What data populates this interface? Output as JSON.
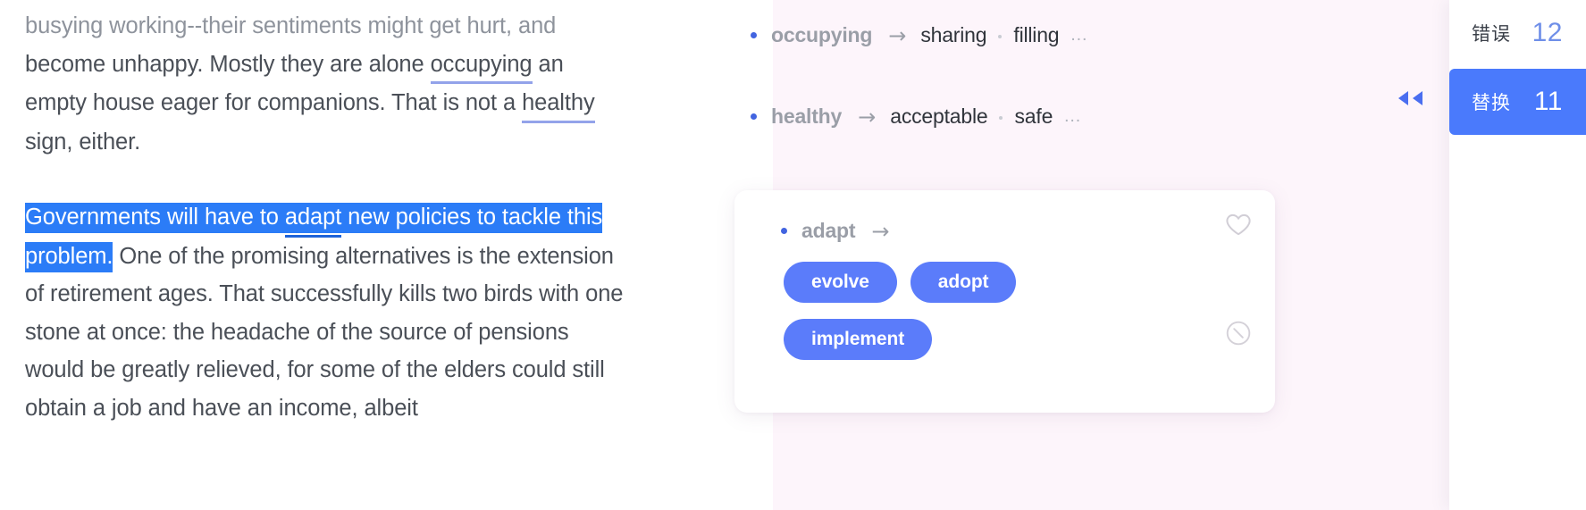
{
  "document": {
    "paragraph_1_faded": "busying working--their sentiments might get hurt, and",
    "paragraph_1_rest_a": "become unhappy. Mostly they are alone ",
    "paragraph_1_word_occupying": "occupying",
    "paragraph_1_rest_b": " an empty house eager for companions. That is not a ",
    "paragraph_1_word_healthy": "healthy",
    "paragraph_1_rest_c": " sign, either.",
    "paragraph_2_selected_a": "Governments will have to ",
    "paragraph_2_selected_word_adapt": "adapt",
    "paragraph_2_selected_b": " new policies to tackle this problem.",
    "paragraph_2_rest": " One of the promising alternatives is the extension of retirement ages. That successfully kills two birds with one stone at once: the headache of the source of pensions would be greatly relieved, for some of the elders could still obtain a job and have an income, albeit"
  },
  "suggestions": {
    "arrow_glyph": "→",
    "more_glyph": "…",
    "rows": [
      {
        "source": "occupying",
        "alternatives": [
          "sharing",
          "filling"
        ],
        "has_more": true
      },
      {
        "source": "healthy",
        "alternatives": [
          "acceptable",
          "safe"
        ],
        "has_more": true
      }
    ],
    "expanded_card": {
      "source": "adapt",
      "arrow_glyph": "→",
      "chips": [
        "evolve",
        "adopt",
        "implement"
      ],
      "favorite_icon": "heart-icon",
      "ignore_icon": "circle-slash-icon"
    }
  },
  "stats": {
    "items": [
      {
        "label": "错误",
        "count": "12",
        "active": false
      },
      {
        "label": "替换",
        "count": "11",
        "active": true
      }
    ],
    "collapse_icon": "double-chevron-left-icon"
  },
  "colors": {
    "selection_blue": "#2b7cf7",
    "underline_periwinkle": "#93a3ea",
    "chip_blue": "#5b7cfa",
    "active_stat_blue": "#4a7afc",
    "panel_pink": "#fdf5fb",
    "count_blue": "#6f8fe8"
  }
}
